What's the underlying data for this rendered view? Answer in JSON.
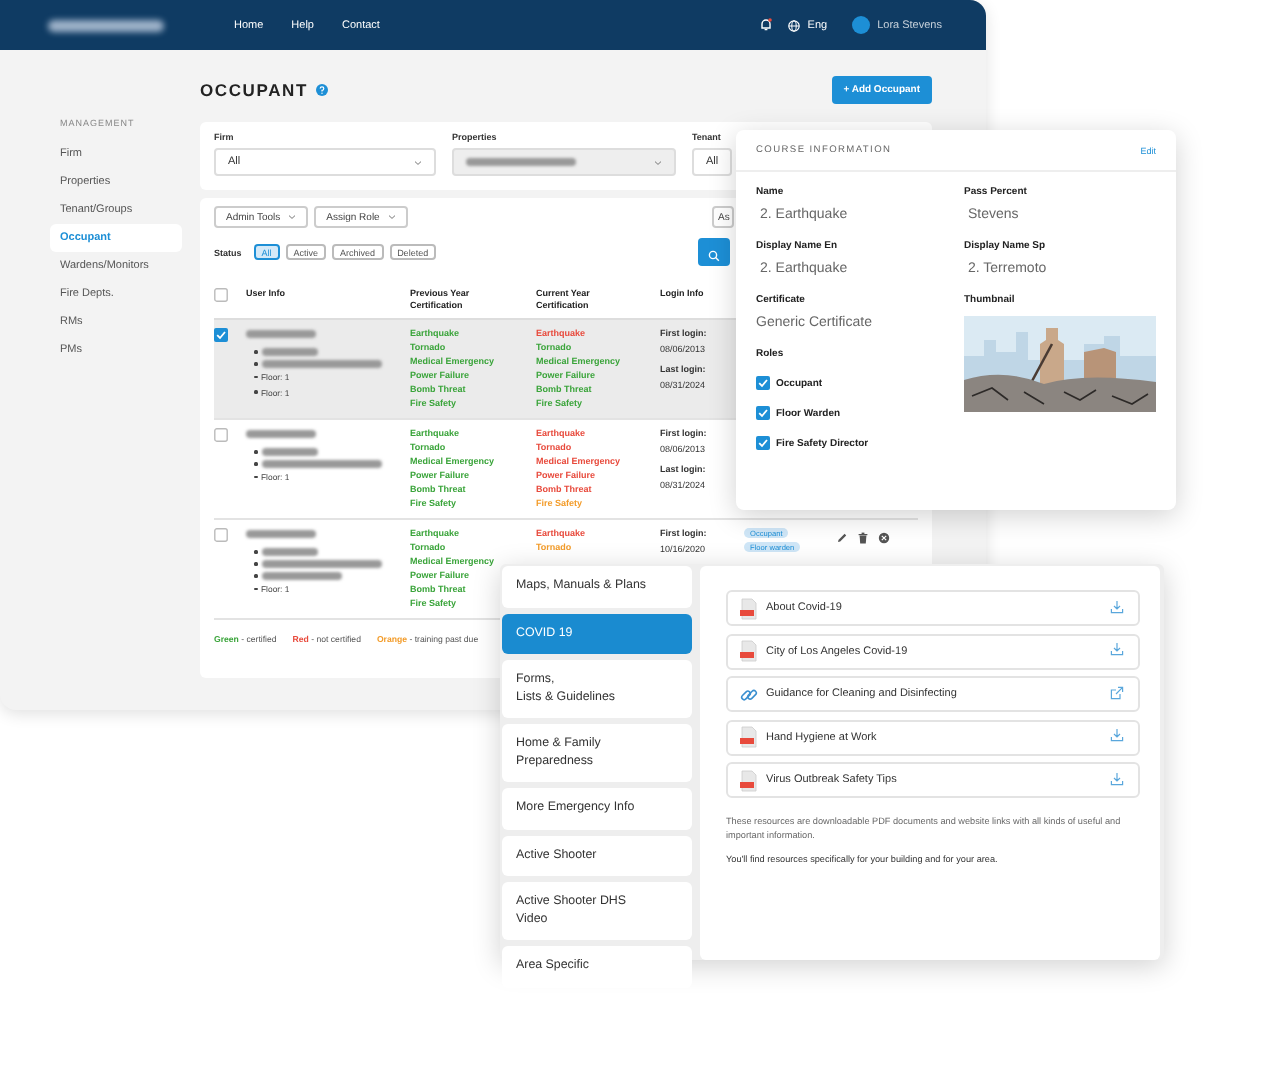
{
  "window": {
    "nav": [
      "Home",
      "Help",
      "Contact"
    ],
    "language": "Eng",
    "user": "Lora Stevens"
  },
  "sidebar": {
    "heading": "MANAGEMENT",
    "items": [
      {
        "label": "Firm",
        "selected": false
      },
      {
        "label": "Properties",
        "selected": false
      },
      {
        "label": "Tenant/Groups",
        "selected": false
      },
      {
        "label": "Occupant",
        "selected": true
      },
      {
        "label": "Wardens/Monitors",
        "selected": false
      },
      {
        "label": "Fire Depts.",
        "selected": false
      },
      {
        "label": "RMs",
        "selected": false
      },
      {
        "label": "PMs",
        "selected": false
      }
    ]
  },
  "page": {
    "title": "OCCUPANT",
    "add_button": "+ Add Occupant"
  },
  "filters": [
    {
      "label": "Firm",
      "value": "All"
    },
    {
      "label": "Properties"
    },
    {
      "label": "Tenant",
      "value": "All"
    }
  ],
  "tools": [
    "Admin Tools",
    "Assign Role"
  ],
  "tool_right": "As",
  "status": {
    "label": "Status",
    "options": [
      {
        "label": "All",
        "selected": true
      },
      {
        "label": "Active",
        "selected": false
      },
      {
        "label": "Archived",
        "selected": false
      },
      {
        "label": "Deleted",
        "selected": false
      }
    ]
  },
  "table": {
    "select_all_checked": false,
    "columns": [
      "User Info",
      "Previous Year\nCertification",
      "Current Year\nCertification",
      "Login Info"
    ],
    "rows": [
      {
        "checked": true,
        "info": [
          {
            "kind": "blurred"
          },
          {
            "kind": "blurred"
          },
          {
            "kind": "text",
            "text": "Floor: 1"
          },
          {
            "kind": "text",
            "text": "Floor: 1"
          }
        ],
        "previous": [
          {
            "label": "Earthquake",
            "color": "#3aa43a"
          },
          {
            "label": "Tornado",
            "color": "#3aa43a"
          },
          {
            "label": "Medical Emergency",
            "color": "#3aa43a"
          },
          {
            "label": "Power Failure",
            "color": "#3aa43a"
          },
          {
            "label": "Bomb Threat",
            "color": "#3aa43a"
          },
          {
            "label": "Fire Safety",
            "color": "#3aa43a"
          }
        ],
        "current": [
          {
            "label": "Earthquake",
            "color": "#e84a3c"
          },
          {
            "label": "Tornado",
            "color": "#3aa43a"
          },
          {
            "label": "Medical Emergency",
            "color": "#3aa43a"
          },
          {
            "label": "Power Failure",
            "color": "#3aa43a"
          },
          {
            "label": "Bomb Threat",
            "color": "#3aa43a"
          },
          {
            "label": "Fire Safety",
            "color": "#3aa43a"
          }
        ],
        "login": [
          "First login:",
          "08/06/2013",
          "Last login:",
          "08/31/2024"
        ]
      },
      {
        "checked": false,
        "info": [
          {
            "kind": "blurred"
          },
          {
            "kind": "blurred"
          },
          {
            "kind": "text",
            "text": "Floor: 1"
          }
        ],
        "previous": [
          {
            "label": "Earthquake",
            "color": "#3aa43a"
          },
          {
            "label": "Tornado",
            "color": "#3aa43a"
          },
          {
            "label": "Medical Emergency",
            "color": "#3aa43a"
          },
          {
            "label": "Power Failure",
            "color": "#3aa43a"
          },
          {
            "label": "Bomb Threat",
            "color": "#3aa43a"
          },
          {
            "label": "Fire Safety",
            "color": "#3aa43a"
          }
        ],
        "current": [
          {
            "label": "Earthquake",
            "color": "#e84a3c"
          },
          {
            "label": "Tornado",
            "color": "#e84a3c"
          },
          {
            "label": "Medical Emergency",
            "color": "#e84a3c"
          },
          {
            "label": "Power Failure",
            "color": "#e84a3c"
          },
          {
            "label": "Bomb Threat",
            "color": "#e84a3c"
          },
          {
            "label": "Fire Safety",
            "color": "#f39c2a"
          }
        ],
        "login": [
          "First login:",
          "08/06/2013",
          "Last login:",
          "08/31/2024"
        ]
      },
      {
        "checked": false,
        "info": [
          {
            "kind": "blurred"
          },
          {
            "kind": "blurred"
          },
          {
            "kind": "blurred"
          },
          {
            "kind": "text",
            "text": "Floor: 1"
          }
        ],
        "previous": [
          {
            "label": "Earthquake",
            "color": "#3aa43a"
          },
          {
            "label": "Tornado",
            "color": "#3aa43a"
          },
          {
            "label": "Medical Emergency",
            "color": "#3aa43a"
          },
          {
            "label": "Power Failure",
            "color": "#3aa43a"
          },
          {
            "label": "Bomb Threat",
            "color": "#3aa43a"
          },
          {
            "label": "Fire Safety",
            "color": "#3aa43a"
          }
        ],
        "current": [
          {
            "label": "Earthquake",
            "color": "#e84a3c"
          },
          {
            "label": "Tornado",
            "color": "#f39c2a"
          }
        ],
        "login": [
          "First login:",
          "10/16/2020"
        ],
        "tags": [
          "Occupant",
          "Floor warden"
        ]
      }
    ]
  },
  "legend": [
    {
      "label": "Green",
      "text": "- certified",
      "color": "#3aa43a"
    },
    {
      "label": "Red",
      "text": "- not certified",
      "color": "#e84a3c"
    },
    {
      "label": "Orange",
      "text": "- training past due",
      "color": "#f39c2a"
    }
  ],
  "course": {
    "title": "COURSE INFORMATION",
    "edit": "Edit",
    "fields": [
      {
        "label": "Name",
        "value": "2. Earthquake"
      },
      {
        "label": "Pass Percent",
        "value": "Stevens"
      },
      {
        "label": "Display Name En",
        "value": "2. Earthquake"
      },
      {
        "label": "Display Name Sp",
        "value": "2. Terremoto"
      }
    ],
    "certificate": {
      "label": "Certificate",
      "value": "Generic Certificate"
    },
    "roles_label": "Roles",
    "roles": [
      {
        "label": "Occupant",
        "checked": true
      },
      {
        "label": "Floor Warden",
        "checked": true
      },
      {
        "label": "Fire Safety Director",
        "checked": true
      }
    ],
    "thumbnail_label": "Thumbnail"
  },
  "resources": {
    "categories": [
      {
        "label": "Maps, Manuals & Plans",
        "selected": false
      },
      {
        "label": "COVID 19",
        "selected": true
      },
      {
        "label": "Forms,\nLists & Guidelines",
        "selected": false
      },
      {
        "label": "Home & Family\nPreparedness",
        "selected": false
      },
      {
        "label": "More Emergency Info",
        "selected": false
      },
      {
        "label": "Active Shooter",
        "selected": false
      },
      {
        "label": "Active Shooter DHS\nVideo",
        "selected": false
      },
      {
        "label": "Area Specific",
        "selected": false
      }
    ],
    "items": [
      {
        "kind": "pdf",
        "label": "About Covid-19"
      },
      {
        "kind": "pdf",
        "label": "City of Los Angeles Covid-19"
      },
      {
        "kind": "link",
        "label": "Guidance for Cleaning and Disinfecting"
      },
      {
        "kind": "pdf",
        "label": "Hand Hygiene at Work"
      },
      {
        "kind": "pdf",
        "label": "Virus Outbreak Safety Tips"
      }
    ],
    "notes": [
      "These resources are downloadable PDF documents and website links with all kinds of useful and important information.",
      "You'll find resources specifically for your building and for your area."
    ]
  }
}
